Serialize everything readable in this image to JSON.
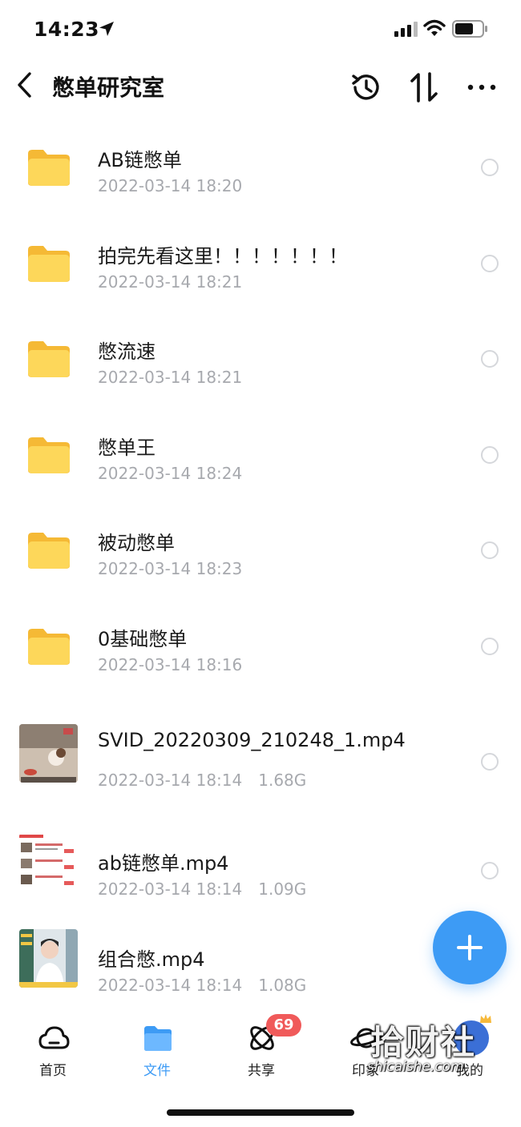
{
  "status_bar": {
    "time": "14:23"
  },
  "nav": {
    "title": "憋单研究室"
  },
  "files": [
    {
      "type": "folder",
      "name": "AB链憋单",
      "date": "2022-03-14 18:20",
      "size": ""
    },
    {
      "type": "folder",
      "name": "拍完先看这里！！！！！！！",
      "date": "2022-03-14 18:21",
      "size": ""
    },
    {
      "type": "folder",
      "name": "憋流速",
      "date": "2022-03-14 18:21",
      "size": ""
    },
    {
      "type": "folder",
      "name": "憋单王",
      "date": "2022-03-14 18:24",
      "size": ""
    },
    {
      "type": "folder",
      "name": "被动憋单",
      "date": "2022-03-14 18:23",
      "size": ""
    },
    {
      "type": "folder",
      "name": "0基础憋单",
      "date": "2022-03-14 18:16",
      "size": ""
    },
    {
      "type": "video",
      "name": "SVID_20220309_210248_1.mp4",
      "date": "2022-03-14 18:14",
      "size": "1.68G"
    },
    {
      "type": "video",
      "name": "ab链憋单.mp4",
      "date": "2022-03-14 18:14",
      "size": "1.09G"
    },
    {
      "type": "video",
      "name": "组合憋.mp4",
      "date": "2022-03-14 18:14",
      "size": "1.08G"
    }
  ],
  "tabs": [
    {
      "label": "首页",
      "icon": "cloud-icon"
    },
    {
      "label": "文件",
      "icon": "folder-icon"
    },
    {
      "label": "共享",
      "icon": "orbit-icon",
      "badge": "69"
    },
    {
      "label": "印象",
      "icon": "planet-icon"
    },
    {
      "label": "我的",
      "icon": "avatar"
    }
  ],
  "watermark": {
    "main": "拾财社",
    "sub": "shicaishe.com"
  },
  "colors": {
    "accent": "#3d9bf5",
    "folder": "#fcd04f",
    "meta_text": "#a7a9ae",
    "badge": "#f05a5a"
  }
}
